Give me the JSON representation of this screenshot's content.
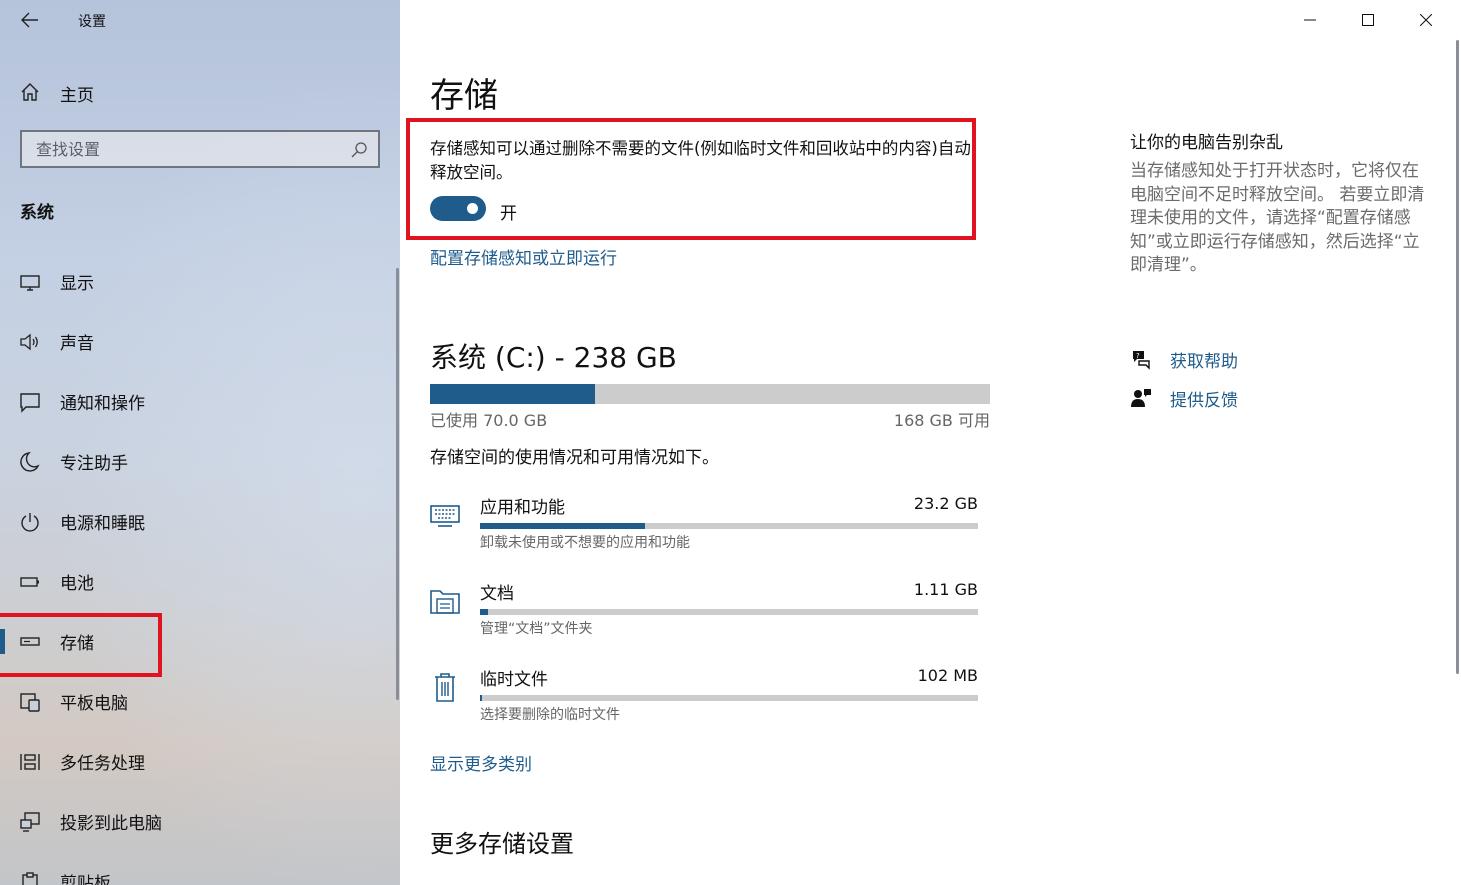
{
  "window": {
    "title": "设置",
    "controls": [
      "minimize-icon",
      "maximize-icon",
      "close-icon"
    ]
  },
  "sidebar": {
    "home_label": "主页",
    "search_placeholder": "查找设置",
    "section_title": "系统",
    "items": [
      {
        "label": "显示",
        "icon": "display-icon"
      },
      {
        "label": "声音",
        "icon": "speaker-icon"
      },
      {
        "label": "通知和操作",
        "icon": "notification-icon"
      },
      {
        "label": "专注助手",
        "icon": "moon-icon"
      },
      {
        "label": "电源和睡眠",
        "icon": "power-icon"
      },
      {
        "label": "电池",
        "icon": "battery-icon"
      },
      {
        "label": "存储",
        "icon": "storage-drive-icon",
        "active": true
      },
      {
        "label": "平板电脑",
        "icon": "tablet-icon"
      },
      {
        "label": "多任务处理",
        "icon": "multitask-icon"
      },
      {
        "label": "投影到此电脑",
        "icon": "project-icon"
      },
      {
        "label": "剪贴板",
        "icon": "clipboard-icon"
      }
    ]
  },
  "main": {
    "title": "存储",
    "storage_sense": {
      "description": "存储感知可以通过删除不需要的文件(例如临时文件和回收站中的内容)自动释放空间。",
      "toggle_state": "开",
      "toggle_on": true,
      "configure_link": "配置存储感知或立即运行"
    },
    "drive": {
      "title": "系统 (C:) - 238 GB",
      "used_fraction": 0.294,
      "used_label": "已使用 70.0 GB",
      "free_label": "168 GB 可用",
      "description": "存储空间的使用情况和可用情况如下。"
    },
    "categories": [
      {
        "name": "应用和功能",
        "size": "23.2 GB",
        "subtitle": "卸载未使用或不想要的应用和功能",
        "fraction": 0.331,
        "icon": "apps-keyboard-icon"
      },
      {
        "name": "文档",
        "size": "1.11 GB",
        "subtitle": "管理“文档”文件夹",
        "fraction": 0.016,
        "icon": "documents-folder-icon"
      },
      {
        "name": "临时文件",
        "size": "102 MB",
        "subtitle": "选择要删除的临时文件",
        "fraction": 0.004,
        "icon": "trash-icon"
      }
    ],
    "show_more_link": "显示更多类别",
    "more_settings_heading": "更多存储设置"
  },
  "right_panel": {
    "title": "让你的电脑告别杂乱",
    "description": "当存储感知处于打开状态时，它将仅在电脑空间不足时释放空间。 若要立即清理未使用的文件，请选择“配置存储感知”或立即运行存储感知，然后选择“立即清理”。",
    "help_link": "获取帮助",
    "feedback_link": "提供反馈"
  },
  "colors": {
    "accent": "#1f5c8c",
    "highlight_border": "#e0141e",
    "bar_track": "#cccccc",
    "secondary_text": "#666666"
  }
}
